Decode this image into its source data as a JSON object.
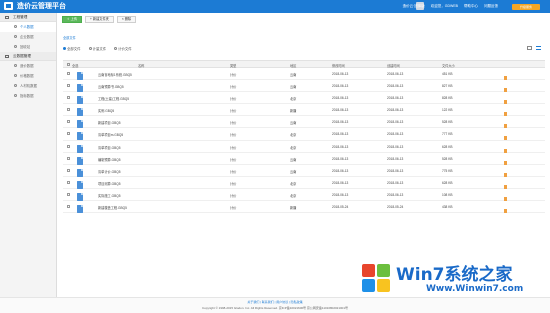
{
  "app": {
    "title": "造价云管理平台"
  },
  "topbar": {
    "links": [
      "造价云·团体版",
      "欢迎您，GDWEB",
      "帮助中心",
      "问题反馈"
    ],
    "cta": "升级服务"
  },
  "sidebar": {
    "groups": [
      {
        "label": "工程管理",
        "items": [
          {
            "label": "个人数据",
            "active": true
          },
          {
            "label": "企业数据",
            "active": false
          },
          {
            "label": "回收站",
            "active": false
          }
        ]
      },
      {
        "label": "云数据管理",
        "items": [
          {
            "label": "造价数据",
            "active": false
          },
          {
            "label": "价格数据",
            "active": false
          },
          {
            "label": "人材机数据",
            "active": false
          },
          {
            "label": "指标数据",
            "active": false
          }
        ]
      }
    ]
  },
  "toolbar": {
    "upload": "上传",
    "new_folder": "新建文件夹",
    "delete": "删除"
  },
  "breadcrumb": "全部文件",
  "filters": [
    {
      "label": "全部文件",
      "selected": true
    },
    {
      "label": "计量文件",
      "selected": false
    },
    {
      "label": "计价文件",
      "selected": false
    }
  ],
  "table": {
    "headers": [
      "全选",
      "名称",
      "类型",
      "地区",
      "修改时间",
      "创建时间",
      "文件大小"
    ],
    "rows": [
      {
        "name": "云南省地标1系统.GBQ5",
        "type": "计价",
        "region": "云南",
        "modified": "2018-06-13",
        "created": "2018-06-13",
        "size": "451 KB"
      },
      {
        "name": "云南预算书.GBQ5",
        "type": "计价",
        "region": "云南",
        "modified": "2018-06-13",
        "created": "2018-06-13",
        "size": "827 KB"
      },
      {
        "name": "工程(土建)工程.GBQ5",
        "type": "计价",
        "region": "北京",
        "modified": "2018-06-13",
        "created": "2018-06-13",
        "size": "828 KB"
      },
      {
        "name": "实例.GBQ5",
        "type": "计价",
        "region": "新疆",
        "modified": "2018-06-13",
        "created": "2018-06-13",
        "size": "122 KB"
      },
      {
        "name": "新建项目.GBQ5",
        "type": "计价",
        "region": "云南",
        "modified": "2018-06-13",
        "created": "2018-06-13",
        "size": "528 KB"
      },
      {
        "name": "清单项目m.GBQ5",
        "type": "计价",
        "region": "北京",
        "modified": "2018-06-13",
        "created": "2018-06-13",
        "size": "777 KB"
      },
      {
        "name": "清单项目.GBQ5",
        "type": "计价",
        "region": "北京",
        "modified": "2018-06-13",
        "created": "2018-06-13",
        "size": "628 KB"
      },
      {
        "name": "编制预算.GBQ5",
        "type": "计价",
        "region": "云南",
        "modified": "2018-06-13",
        "created": "2018-06-13",
        "size": "528 KB"
      },
      {
        "name": "清单计价.GBQ5",
        "type": "计价",
        "region": "云南",
        "modified": "2018-06-13",
        "created": "2018-06-13",
        "size": "775 KB"
      },
      {
        "name": "项目测算.GBQ5",
        "type": "计价",
        "region": "北京",
        "modified": "2018-06-13",
        "created": "2018-06-13",
        "size": "628 KB"
      },
      {
        "name": "实际施工.GBQ5",
        "type": "计价",
        "region": "北京",
        "modified": "2018-06-13",
        "created": "2018-06-13",
        "size": "108 KB"
      },
      {
        "name": "新建楼盘工程.GBQ5",
        "type": "计价",
        "region": "新疆",
        "modified": "2018-05-24",
        "created": "2018-05-24",
        "size": "438 KB"
      }
    ]
  },
  "footer": {
    "links": "关于我们 | 联系我们 | 用户协议 | 隐私政策",
    "copyright": "Copyright © 1998-2015 Glodon. Inc. All Rights Reserved. 京ICP备10021606号 京公网安备11010802021001号"
  },
  "watermark": {
    "title": "Win7系统之家",
    "url": "Www.Winwin7.com"
  },
  "colors": {
    "brand": "#1c7bd4",
    "accent": "#f5a623",
    "upload": "#5cb85c",
    "action": "#f0a040"
  }
}
